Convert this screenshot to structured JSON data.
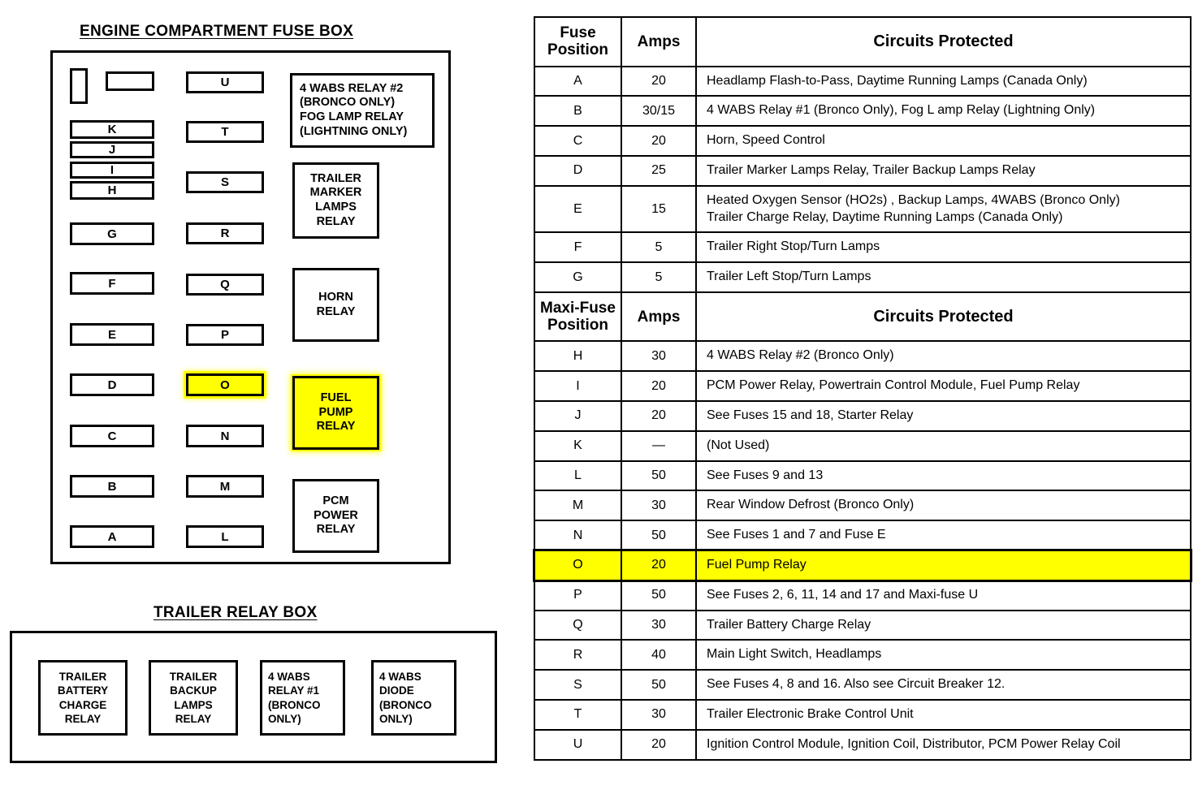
{
  "left_panel": {
    "engine_title": "ENGINE COMPARTMENT FUSE BOX",
    "trailer_title": "TRAILER RELAY BOX",
    "fuses_left_column": [
      {
        "label": "K"
      },
      {
        "label": "J"
      },
      {
        "label": "I"
      },
      {
        "label": "H"
      },
      {
        "label": "G"
      },
      {
        "label": "F"
      },
      {
        "label": "E"
      },
      {
        "label": "D"
      },
      {
        "label": "C"
      },
      {
        "label": "B"
      },
      {
        "label": "A"
      }
    ],
    "fuses_middle_column": [
      {
        "label": "U"
      },
      {
        "label": "T"
      },
      {
        "label": "S"
      },
      {
        "label": "R"
      },
      {
        "label": "Q"
      },
      {
        "label": "P"
      },
      {
        "label": "O",
        "highlighted": true
      },
      {
        "label": "N"
      },
      {
        "label": "M"
      },
      {
        "label": "L"
      }
    ],
    "unlabeled_slots": [
      {
        "name": "blank-slot-vertical"
      },
      {
        "name": "blank-slot-horizontal"
      }
    ],
    "relays": [
      {
        "name": "4-wabs-relay-2-fog-lamp-relay",
        "text": "4 WABS RELAY  #2\n(BRONCO ONLY)\nFOG LAMP RELAY\n(LIGHTNING ONLY)"
      },
      {
        "name": "trailer-marker-lamps-relay",
        "text": "TRAILER\nMARKER\nLAMPS\nRELAY"
      },
      {
        "name": "horn-relay",
        "text": "HORN\nRELAY"
      },
      {
        "name": "fuel-pump-relay",
        "text": "FUEL\nPUMP\nRELAY",
        "highlighted": true
      },
      {
        "name": "pcm-power-relay",
        "text": "PCM\nPOWER\nRELAY"
      }
    ],
    "trailer_relays": [
      {
        "name": "trailer-battery-charge-relay",
        "text": "TRAILER\nBATTERY\nCHARGE\nRELAY"
      },
      {
        "name": "trailer-backup-lamps-relay",
        "text": "TRAILER\nBACKUP\nLAMPS\nRELAY"
      },
      {
        "name": "4-wabs-relay-1",
        "text": "4 WABS\nRELAY  #1\n(BRONCO\nONLY)"
      },
      {
        "name": "4-wabs-diode",
        "text": "4 WABS\nDIODE\n(BRONCO\nONLY)"
      }
    ]
  },
  "table": {
    "header_fuse": {
      "position": "Fuse\nPosition",
      "amps": "Amps",
      "circuits": "Circuits Protected"
    },
    "header_maxi": {
      "position": "Maxi-Fuse\nPosition",
      "amps": "Amps",
      "circuits": "Circuits Protected"
    },
    "fuse_rows": [
      {
        "position": "A",
        "amps": "20",
        "circuits": "Headlamp Flash-to-Pass, Daytime Running Lamps (Canada Only)"
      },
      {
        "position": "B",
        "amps": "30/15",
        "circuits": "4 WABS Relay #1 (Bronco Only), Fog L amp Relay (Lightning Only)"
      },
      {
        "position": "C",
        "amps": "20",
        "circuits": "Horn, Speed Control"
      },
      {
        "position": "D",
        "amps": "25",
        "circuits": "Trailer Marker Lamps Relay, Trailer Backup Lamps Relay"
      },
      {
        "position": "E",
        "amps": "15",
        "circuits": "Heated Oxygen Sensor (HO2s) , Backup Lamps, 4WABS (Bronco Only)\nTrailer Charge Relay, Daytime Running Lamps (Canada Only)"
      },
      {
        "position": "F",
        "amps": "5",
        "circuits": "Trailer Right Stop/Turn Lamps"
      },
      {
        "position": "G",
        "amps": "5",
        "circuits": "Trailer Left Stop/Turn Lamps"
      }
    ],
    "maxi_rows": [
      {
        "position": "H",
        "amps": "30",
        "circuits": "4 WABS Relay #2 (Bronco Only)"
      },
      {
        "position": "I",
        "amps": "20",
        "circuits": "PCM Power Relay, Powertrain Control Module, Fuel Pump Relay"
      },
      {
        "position": "J",
        "amps": "20",
        "circuits": "See Fuses 15 and 18, Starter Relay"
      },
      {
        "position": "K",
        "amps": "—",
        "circuits": "(Not Used)"
      },
      {
        "position": "L",
        "amps": "50",
        "circuits": "See Fuses 9 and 13"
      },
      {
        "position": "M",
        "amps": "30",
        "circuits": "Rear Window Defrost (Bronco Only)"
      },
      {
        "position": "N",
        "amps": "50",
        "circuits": "See Fuses 1 and 7 and Fuse E"
      },
      {
        "position": "O",
        "amps": "20",
        "circuits": "Fuel Pump Relay",
        "highlighted": true
      },
      {
        "position": "P",
        "amps": "50",
        "circuits": "See Fuses 2, 6, 11, 14 and 17 and Maxi-fuse U"
      },
      {
        "position": "Q",
        "amps": "30",
        "circuits": "Trailer Battery Charge Relay"
      },
      {
        "position": "R",
        "amps": "40",
        "circuits": "Main Light Switch, Headlamps"
      },
      {
        "position": "S",
        "amps": "50",
        "circuits": "See Fuses 4, 8 and 16. Also see Circuit Breaker 12."
      },
      {
        "position": "T",
        "amps": "30",
        "circuits": "Trailer Electronic Brake Control Unit"
      },
      {
        "position": "U",
        "amps": "20",
        "circuits": "Ignition Control Module, Ignition Coil, Distributor, PCM Power Relay Coil"
      }
    ]
  },
  "colors": {
    "highlight": "#FFFF00",
    "line": "#000000",
    "background": "#FFFFFF"
  }
}
